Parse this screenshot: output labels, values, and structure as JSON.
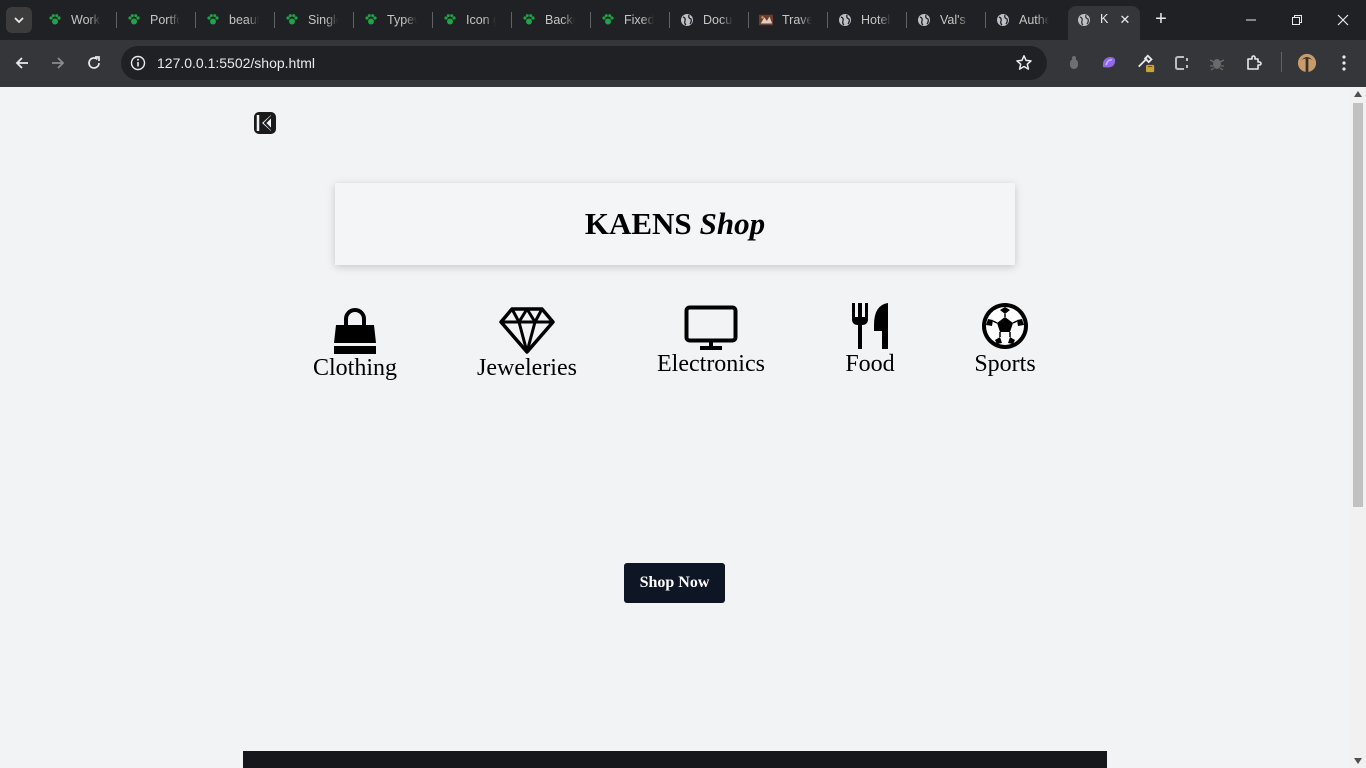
{
  "browser": {
    "tabs": [
      {
        "label": "Work",
        "icon": "paw-icon"
      },
      {
        "label": "Portfo",
        "icon": "paw-icon"
      },
      {
        "label": "beaut",
        "icon": "paw-icon"
      },
      {
        "label": "Single",
        "icon": "paw-icon"
      },
      {
        "label": "Typew",
        "icon": "paw-icon"
      },
      {
        "label": "Icon g",
        "icon": "paw-icon"
      },
      {
        "label": "Backg",
        "icon": "paw-icon"
      },
      {
        "label": "Fixed",
        "icon": "paw-icon"
      },
      {
        "label": "Docur",
        "icon": "globe-icon"
      },
      {
        "label": "Travel",
        "icon": "travel-icon"
      },
      {
        "label": "Hotel",
        "icon": "globe-icon"
      },
      {
        "label": "Val's D",
        "icon": "globe-icon"
      },
      {
        "label": "Authe",
        "icon": "globe-icon"
      }
    ],
    "active_tab": {
      "label": "K",
      "icon": "globe-icon"
    },
    "url": "127.0.0.1:5502/shop.html",
    "colors": {
      "tab_icon_green": "#1ea446",
      "chrome_dark": "#202124",
      "toolbar": "#35363a"
    }
  },
  "page": {
    "brand": {
      "name": "KAENS",
      "emphasis": "Shop"
    },
    "categories": [
      {
        "label": "Clothing",
        "icon": "shopping-bag-icon"
      },
      {
        "label": "Jeweleries",
        "icon": "diamond-icon"
      },
      {
        "label": "Electronics",
        "icon": "monitor-icon"
      },
      {
        "label": "Food",
        "icon": "utensils-icon"
      },
      {
        "label": "Sports",
        "icon": "soccer-ball-icon"
      }
    ],
    "cta": "Shop Now",
    "colors": {
      "background": "#f2f3f5",
      "button": "#0e1525",
      "footer": "#15171a"
    }
  }
}
